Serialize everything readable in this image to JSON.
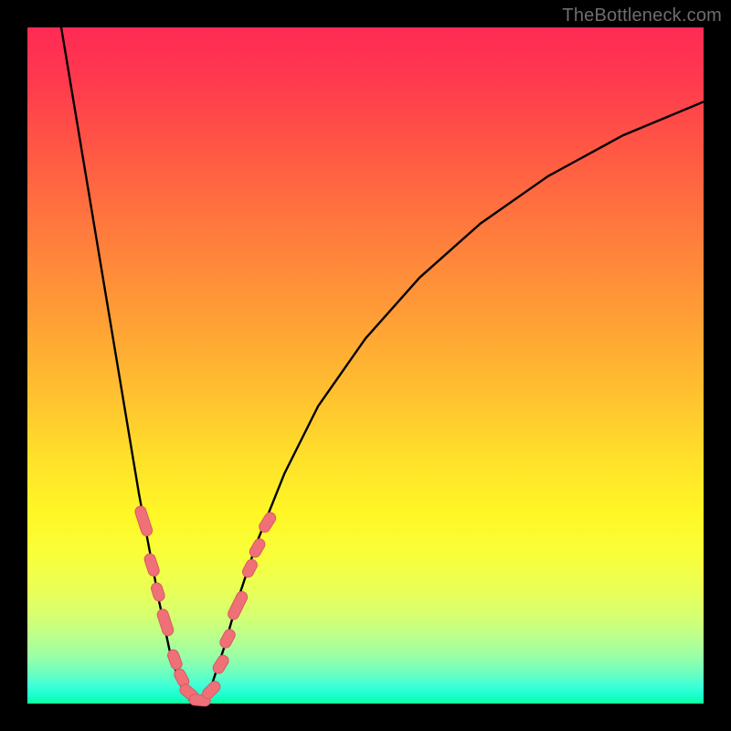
{
  "watermark": "TheBottleneck.com",
  "chart_data": {
    "type": "line",
    "title": "",
    "xlabel": "",
    "ylabel": "",
    "xlim": [
      0,
      100
    ],
    "ylim": [
      0,
      100
    ],
    "grid": false,
    "background_gradient": {
      "direction": "vertical",
      "stops": [
        {
          "pos": 0,
          "color": "#ff2a55"
        },
        {
          "pos": 50,
          "color": "#ffc030"
        },
        {
          "pos": 75,
          "color": "#fff726"
        },
        {
          "pos": 100,
          "color": "#0fff96"
        }
      ]
    },
    "series": [
      {
        "name": "bottleneck-curve-left",
        "stroke": "#000000",
        "values": [
          {
            "x": 5.0,
            "y": 100.0
          },
          {
            "x": 7.0,
            "y": 88.0
          },
          {
            "x": 9.0,
            "y": 76.0
          },
          {
            "x": 11.0,
            "y": 64.0
          },
          {
            "x": 13.0,
            "y": 52.0
          },
          {
            "x": 15.0,
            "y": 40.0
          },
          {
            "x": 16.5,
            "y": 31.0
          },
          {
            "x": 18.0,
            "y": 23.0
          },
          {
            "x": 19.5,
            "y": 15.0
          },
          {
            "x": 21.0,
            "y": 8.0
          },
          {
            "x": 22.5,
            "y": 3.0
          },
          {
            "x": 24.0,
            "y": 0.5
          },
          {
            "x": 25.5,
            "y": 0.0
          }
        ]
      },
      {
        "name": "bottleneck-curve-right",
        "stroke": "#000000",
        "values": [
          {
            "x": 25.5,
            "y": 0.0
          },
          {
            "x": 27.0,
            "y": 2.0
          },
          {
            "x": 29.0,
            "y": 8.0
          },
          {
            "x": 31.0,
            "y": 15.0
          },
          {
            "x": 34.0,
            "y": 24.0
          },
          {
            "x": 38.0,
            "y": 34.0
          },
          {
            "x": 43.0,
            "y": 44.0
          },
          {
            "x": 50.0,
            "y": 54.0
          },
          {
            "x": 58.0,
            "y": 63.0
          },
          {
            "x": 67.0,
            "y": 71.0
          },
          {
            "x": 77.0,
            "y": 78.0
          },
          {
            "x": 88.0,
            "y": 84.0
          },
          {
            "x": 100.0,
            "y": 89.0
          }
        ]
      }
    ],
    "markers": {
      "name": "sample-points",
      "shape": "rounded-bar",
      "fill": "#f07078",
      "stroke": "#d85a62",
      "points": [
        {
          "x": 17.2,
          "y": 27.0,
          "len": 5.0,
          "angle": 72
        },
        {
          "x": 18.4,
          "y": 20.5,
          "len": 3.2,
          "angle": 72
        },
        {
          "x": 19.3,
          "y": 16.5,
          "len": 2.2,
          "angle": 72
        },
        {
          "x": 20.4,
          "y": 12.0,
          "len": 4.2,
          "angle": 72
        },
        {
          "x": 21.8,
          "y": 6.5,
          "len": 2.6,
          "angle": 70
        },
        {
          "x": 22.8,
          "y": 3.8,
          "len": 2.2,
          "angle": 62
        },
        {
          "x": 23.9,
          "y": 1.6,
          "len": 2.6,
          "angle": 40
        },
        {
          "x": 25.5,
          "y": 0.5,
          "len": 2.8,
          "angle": 5
        },
        {
          "x": 27.2,
          "y": 2.0,
          "len": 2.6,
          "angle": -45
        },
        {
          "x": 28.6,
          "y": 5.8,
          "len": 2.4,
          "angle": -58
        },
        {
          "x": 29.6,
          "y": 9.6,
          "len": 2.4,
          "angle": -62
        },
        {
          "x": 31.1,
          "y": 14.5,
          "len": 4.8,
          "angle": -64
        },
        {
          "x": 32.9,
          "y": 20.0,
          "len": 2.2,
          "angle": -62
        },
        {
          "x": 34.0,
          "y": 23.0,
          "len": 2.4,
          "angle": -60
        },
        {
          "x": 35.5,
          "y": 26.8,
          "len": 2.8,
          "angle": -58
        }
      ]
    }
  }
}
